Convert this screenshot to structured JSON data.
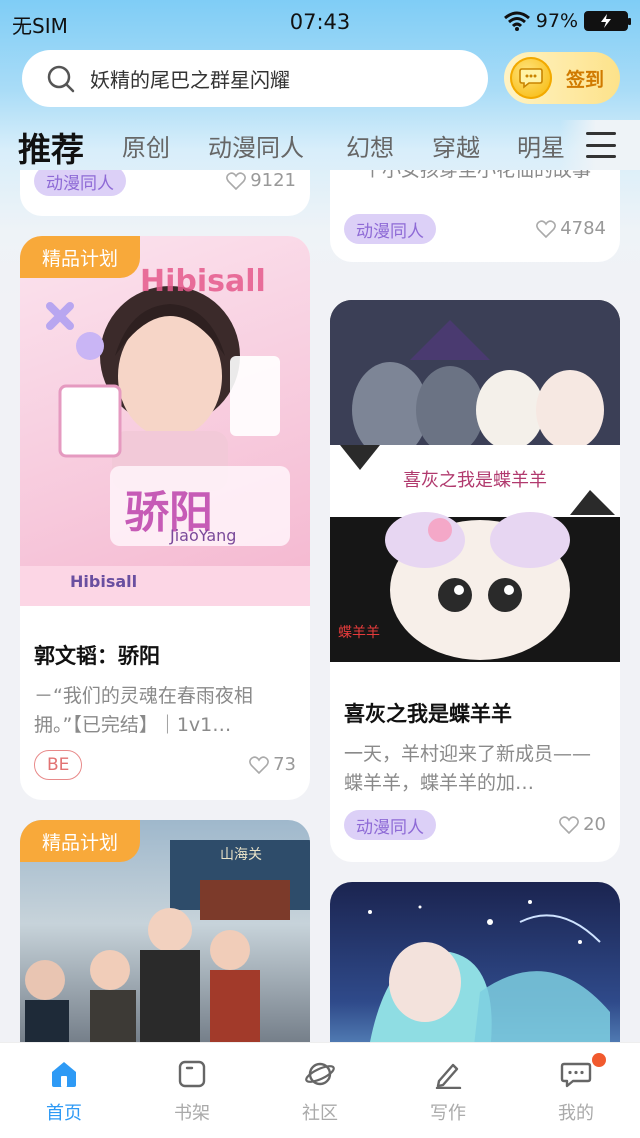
{
  "status": {
    "carrier": "无SIM",
    "time": "07:43",
    "battery": "97%"
  },
  "search": {
    "placeholder": "妖精的尾巴之群星闪耀",
    "checkin": "签到"
  },
  "tabs": [
    {
      "label": "推荐",
      "active": true
    },
    {
      "label": "原创"
    },
    {
      "label": "动漫同人"
    },
    {
      "label": "幻想"
    },
    {
      "label": "穿越"
    },
    {
      "label": "明星"
    }
  ],
  "cards": {
    "partial_left": {
      "tag": "动漫同人",
      "likes": "9121"
    },
    "partial_right": {
      "desc": "一个小女孩穿至小花仙的故事",
      "tag": "动漫同人",
      "likes": "4784"
    },
    "card1": {
      "badge": "精品计划",
      "cover_texts": {
        "brand": "Hibisall",
        "art": "骄阳",
        "art_sub": "JiaoYang"
      },
      "title": "郭文韬：骄阳",
      "desc": "－“我们的灵魂在春雨夜相拥。”【已完结】｜1v1…",
      "tag": "BE",
      "likes": "73"
    },
    "card2": {
      "cover_caption": "喜灰之我是蝶羊羊",
      "cover_watermark": "蝶羊羊",
      "title": "喜灰之我是蝶羊羊",
      "desc": "一天，羊村迎来了新成员——蝶羊羊，蝶羊羊的加…",
      "tag": "动漫同人",
      "likes": "20"
    },
    "card3": {
      "badge": "精品计划",
      "cover_sign": "山海关"
    },
    "card4": {}
  },
  "nav": [
    {
      "label": "首页",
      "icon": "home-icon",
      "active": true
    },
    {
      "label": "书架",
      "icon": "bookshelf-icon"
    },
    {
      "label": "社区",
      "icon": "planet-icon"
    },
    {
      "label": "写作",
      "icon": "pen-icon"
    },
    {
      "label": "我的",
      "icon": "chat-icon",
      "dot": true
    }
  ],
  "colors": {
    "accent": "#2e9af5",
    "premium": "#f8a93a",
    "tag_purple": "#8e6ad6",
    "badge_dot": "#f15a2e"
  }
}
